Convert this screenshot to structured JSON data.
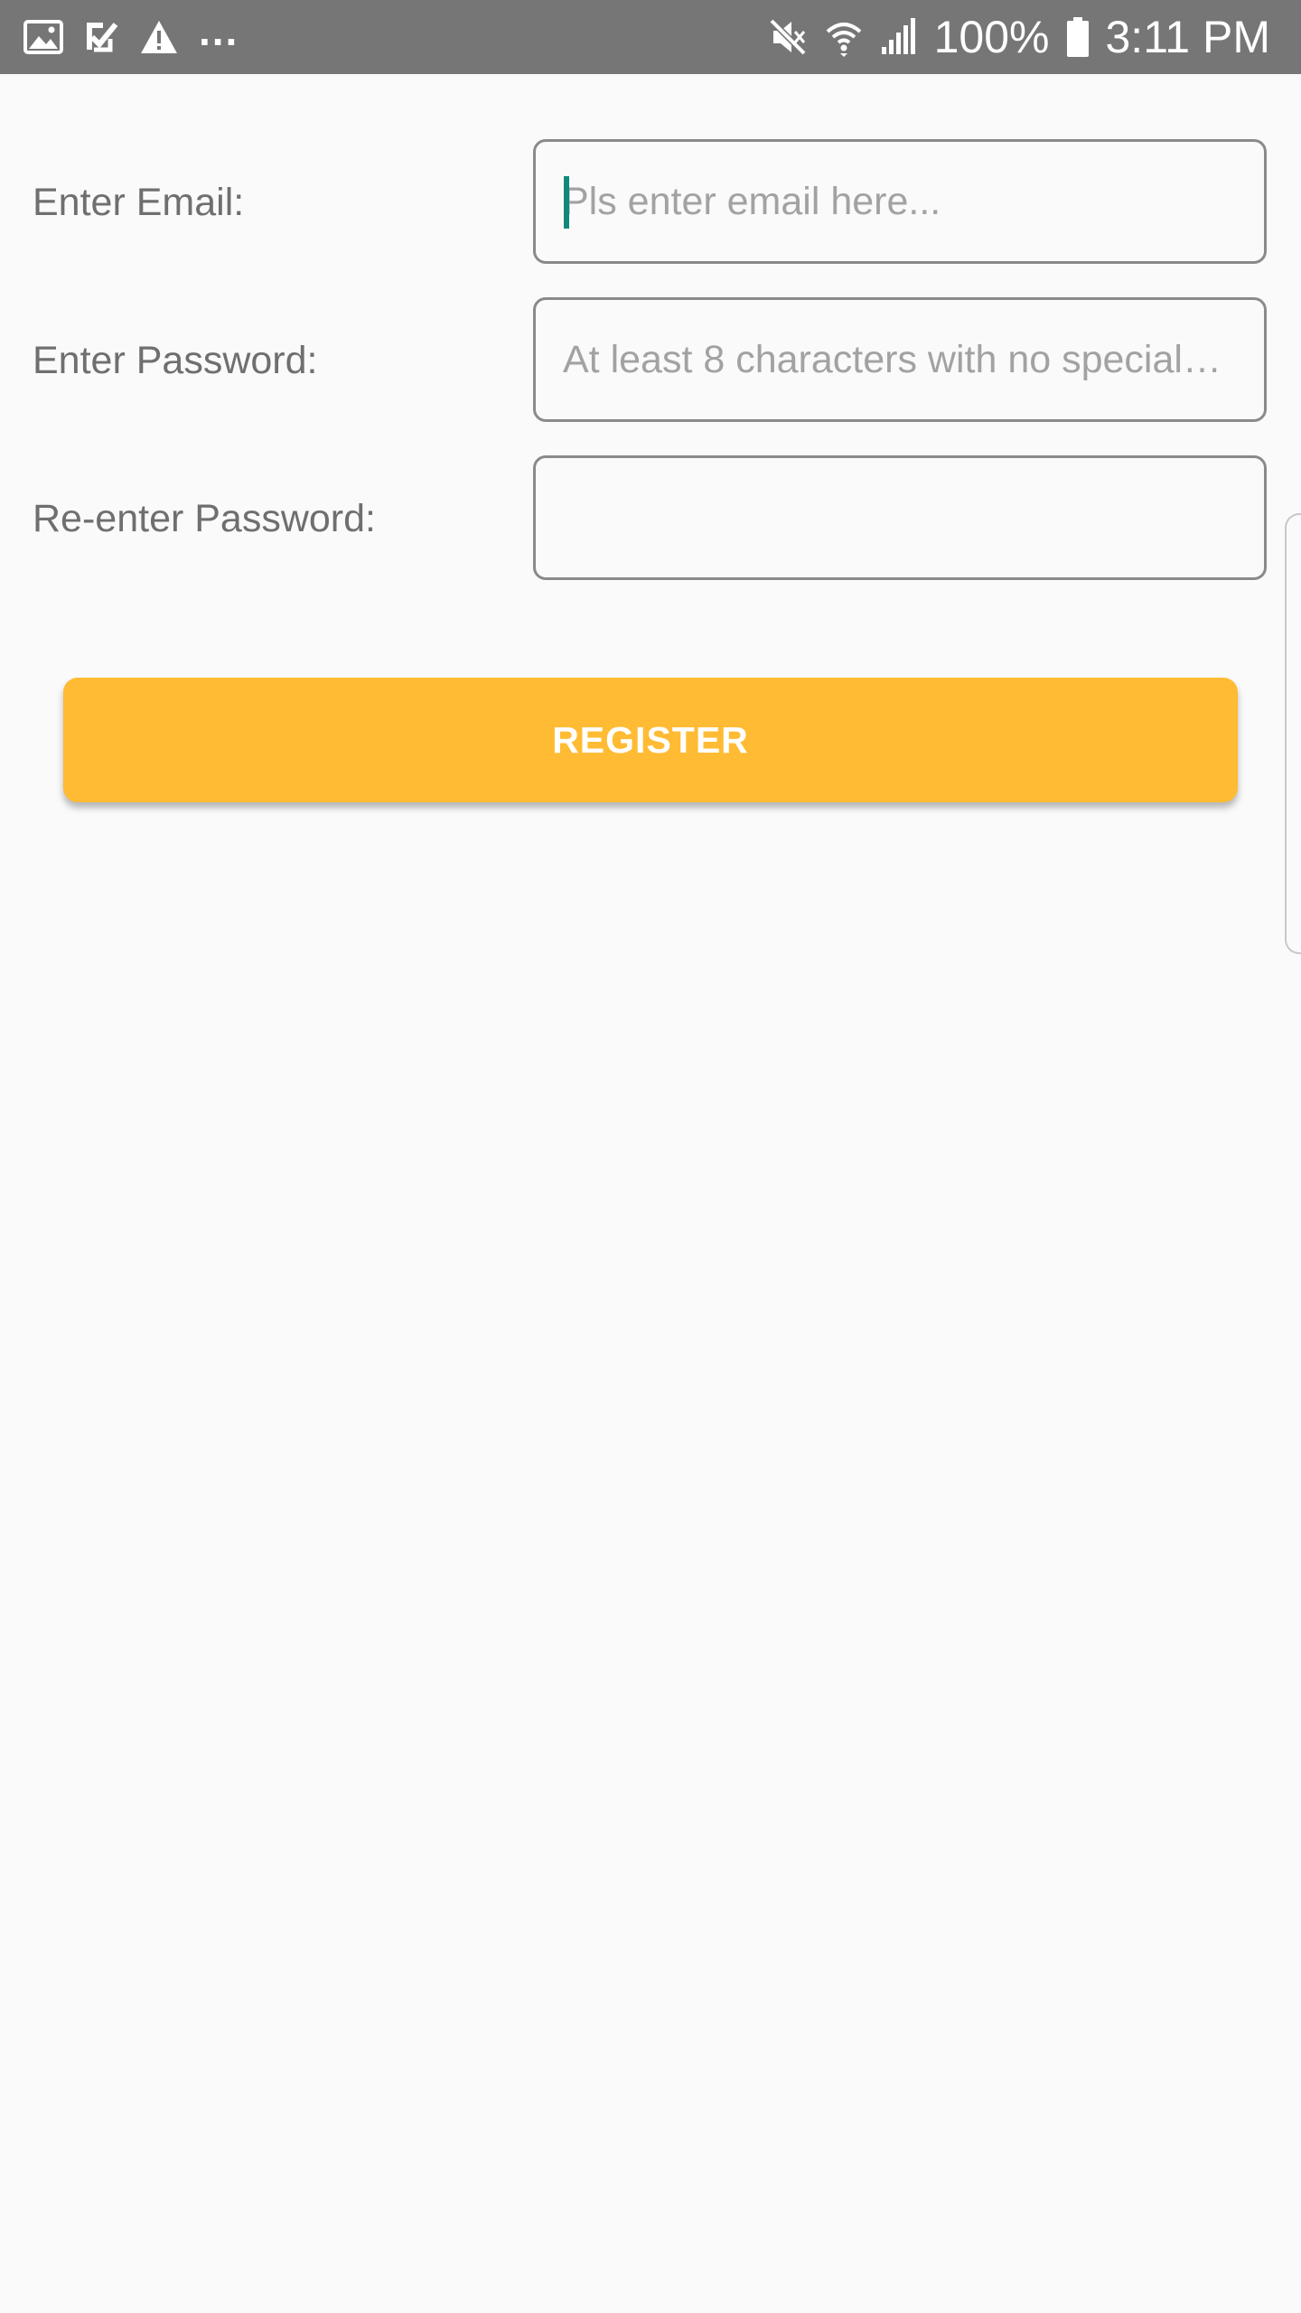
{
  "status_bar": {
    "left_icons": [
      "image-icon",
      "task-check-icon",
      "warning-icon"
    ],
    "more_indicator": "...",
    "right_icons": [
      "mute-icon",
      "wifi-icon",
      "signal-icon",
      "battery-icon"
    ],
    "battery": "100%",
    "time": "3:11 PM"
  },
  "form": {
    "email": {
      "label": "Enter Email:",
      "value": "",
      "placeholder": "Pls enter email here..."
    },
    "password": {
      "label": "Enter Password:",
      "value": "",
      "placeholder": "At least 8 characters with no special…"
    },
    "confirm_password": {
      "label": "Re-enter Password:",
      "value": "",
      "placeholder": ""
    },
    "register_label": "REGISTER"
  },
  "colors": {
    "status_bar": "#767676",
    "background": "#fafafa",
    "button": "#ffbb33",
    "caret": "#0f8a7a",
    "field_border": "#8a8a8a"
  }
}
